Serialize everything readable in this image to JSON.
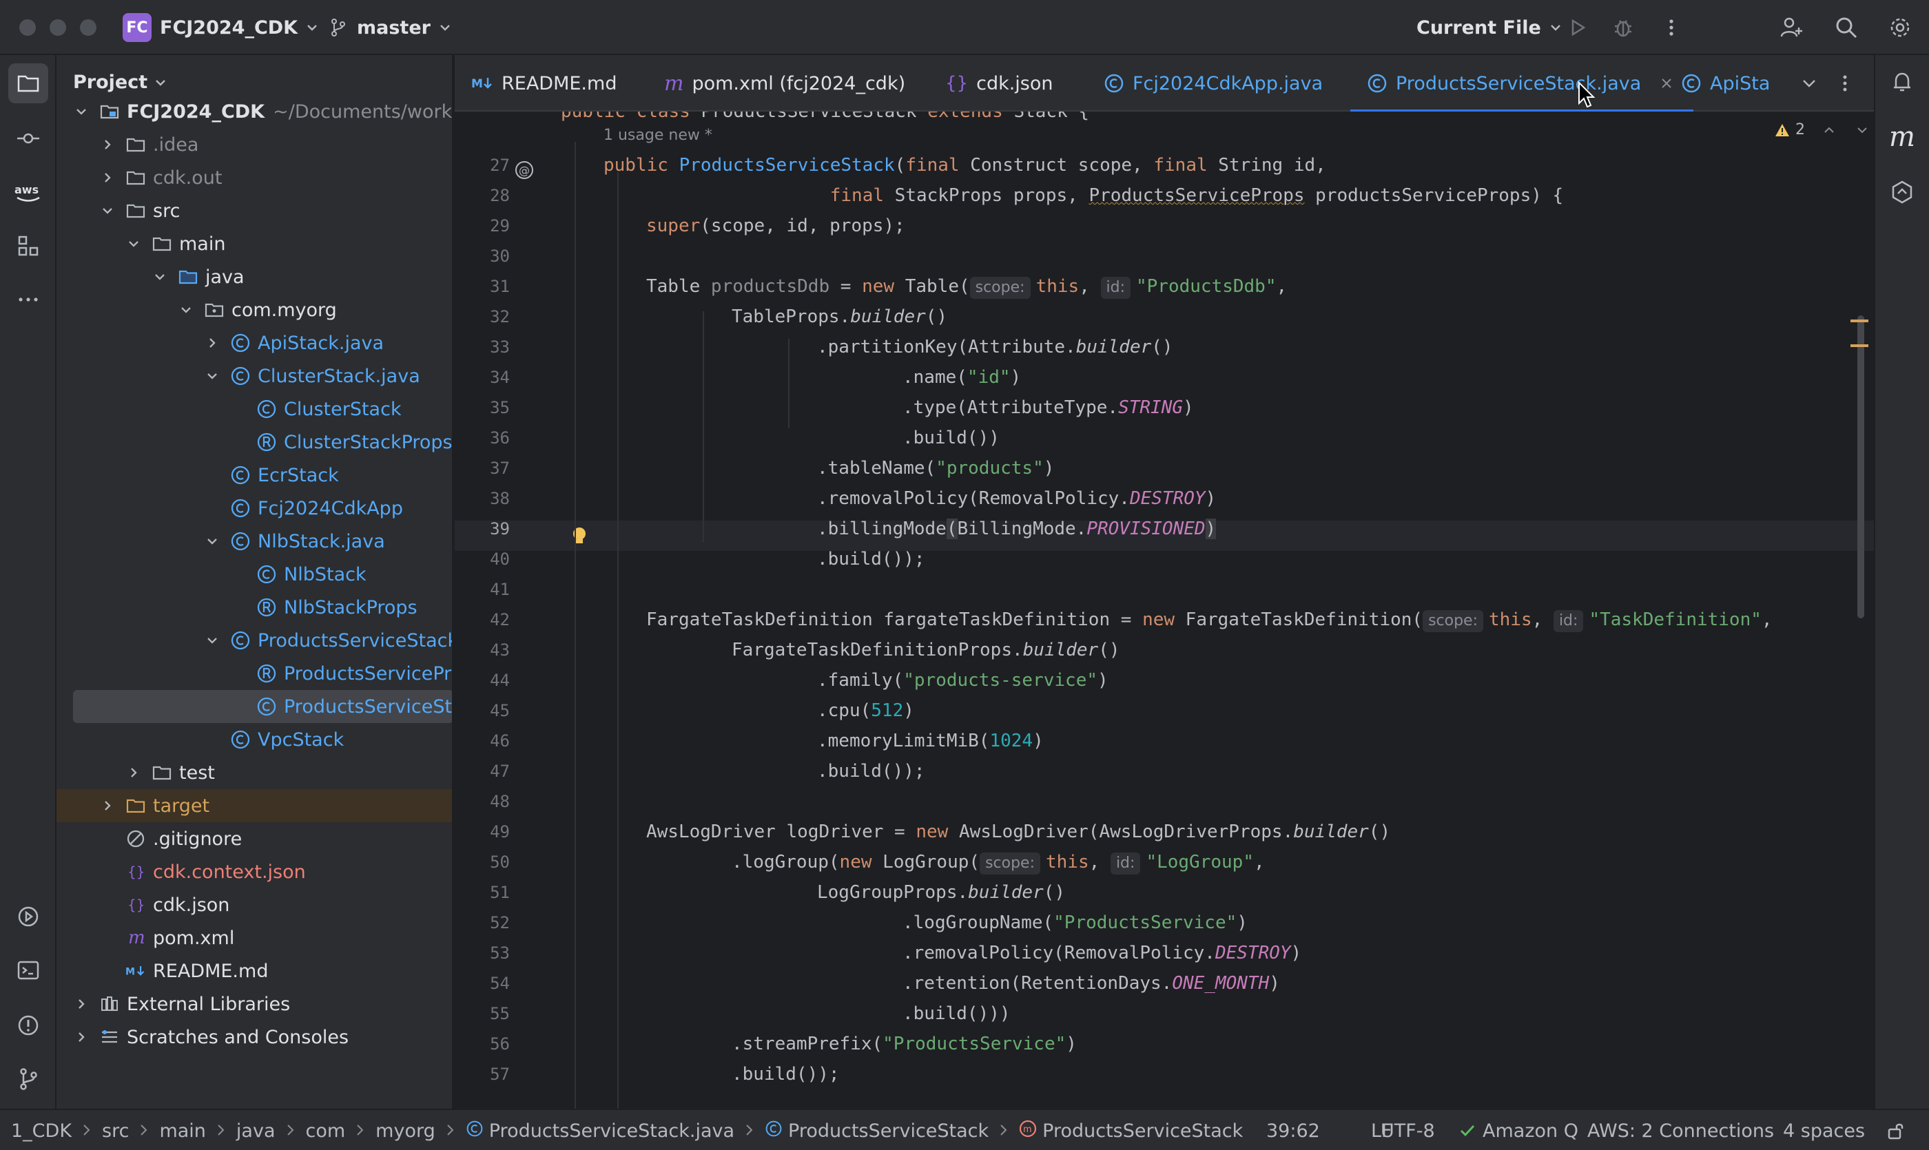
{
  "titlebar": {
    "project_badge": "FC",
    "project_name": "FCJ2024_CDK",
    "branch": "master",
    "run_config": "Current File"
  },
  "project_panel": {
    "title": "Project",
    "tree": [
      {
        "label": "FCJ2024_CDK",
        "hint": "~/Documents/worksho",
        "indent": 0,
        "chev": "down",
        "icon": "module-folder-icon",
        "color": "white",
        "bold": true
      },
      {
        "label": ".idea",
        "indent": 1,
        "chev": "right",
        "icon": "folder-icon",
        "color": "gray"
      },
      {
        "label": "cdk.out",
        "indent": 1,
        "chev": "right",
        "icon": "folder-icon",
        "color": "gray"
      },
      {
        "label": "src",
        "indent": 1,
        "chev": "down",
        "icon": "folder-icon",
        "color": "white"
      },
      {
        "label": "main",
        "indent": 2,
        "chev": "down",
        "icon": "folder-icon",
        "color": "white"
      },
      {
        "label": "java",
        "indent": 3,
        "chev": "down",
        "icon": "source-folder-icon",
        "color": "white"
      },
      {
        "label": "com.myorg",
        "indent": 4,
        "chev": "down",
        "icon": "package-icon",
        "color": "white"
      },
      {
        "label": "ApiStack.java",
        "indent": 5,
        "chev": "right",
        "icon": "class-icon",
        "color": "cls"
      },
      {
        "label": "ClusterStack.java",
        "indent": 5,
        "chev": "down",
        "icon": "class-icon",
        "color": "cls"
      },
      {
        "label": "ClusterStack",
        "indent": 6,
        "chev": "none",
        "icon": "class-icon",
        "color": "cls"
      },
      {
        "label": "ClusterStackProps",
        "indent": 6,
        "chev": "none",
        "icon": "record-icon",
        "color": "cls"
      },
      {
        "label": "EcrStack",
        "indent": 5,
        "chev": "none",
        "icon": "class-icon",
        "color": "cls"
      },
      {
        "label": "Fcj2024CdkApp",
        "indent": 5,
        "chev": "none",
        "icon": "class-icon",
        "color": "cls"
      },
      {
        "label": "NlbStack.java",
        "indent": 5,
        "chev": "down",
        "icon": "class-icon",
        "color": "cls"
      },
      {
        "label": "NlbStack",
        "indent": 6,
        "chev": "none",
        "icon": "class-icon",
        "color": "cls"
      },
      {
        "label": "NlbStackProps",
        "indent": 6,
        "chev": "none",
        "icon": "record-icon",
        "color": "cls"
      },
      {
        "label": "ProductsServiceStack.j",
        "indent": 5,
        "chev": "down",
        "icon": "class-icon",
        "color": "cls"
      },
      {
        "label": "ProductsServicePro",
        "indent": 6,
        "chev": "none",
        "icon": "record-icon",
        "color": "cls"
      },
      {
        "label": "ProductsServiceSta",
        "indent": 6,
        "chev": "none",
        "icon": "class-icon",
        "color": "cls",
        "selected": true
      },
      {
        "label": "VpcStack",
        "indent": 5,
        "chev": "none",
        "icon": "class-icon",
        "color": "cls"
      },
      {
        "label": "test",
        "indent": 2,
        "chev": "right",
        "icon": "folder-icon",
        "color": "white"
      },
      {
        "label": "target",
        "indent": 1,
        "chev": "right",
        "icon": "excluded-folder-icon",
        "color": "orange",
        "excluded": true
      },
      {
        "label": ".gitignore",
        "indent": 1,
        "chev": "none",
        "icon": "ignore-file-icon",
        "color": "white"
      },
      {
        "label": "cdk.context.json",
        "indent": 1,
        "chev": "none",
        "icon": "json-icon",
        "color": "red"
      },
      {
        "label": "cdk.json",
        "indent": 1,
        "chev": "none",
        "icon": "json-icon",
        "color": "white"
      },
      {
        "label": "pom.xml",
        "indent": 1,
        "chev": "none",
        "icon": "maven-icon",
        "color": "white"
      },
      {
        "label": "README.md",
        "indent": 1,
        "chev": "none",
        "icon": "markdown-icon",
        "color": "white"
      },
      {
        "label": "External Libraries",
        "indent": 0,
        "chev": "right",
        "icon": "libraries-icon",
        "color": "white"
      },
      {
        "label": "Scratches and Consoles",
        "indent": 0,
        "chev": "right",
        "icon": "scratches-icon",
        "color": "white"
      }
    ]
  },
  "tabs": [
    {
      "label": "README.md",
      "icon": "markdown-icon",
      "active": false
    },
    {
      "label": "pom.xml (fcj2024_cdk)",
      "icon": "maven-icon",
      "active": false
    },
    {
      "label": "cdk.json",
      "icon": "json-icon",
      "active": false
    },
    {
      "label": "Fcj2024CdkApp.java",
      "icon": "class-icon",
      "active": false
    },
    {
      "label": "ProductsServiceStack.java",
      "icon": "class-icon",
      "active": true
    },
    {
      "label": "ApiStack",
      "icon": "class-icon",
      "active": false
    }
  ],
  "editor": {
    "top_partial": "public class ProductsServiceStack extends Stack {",
    "usage_hint": "1 usage   new *",
    "warnings_count": "2",
    "line_numbers": [
      "27",
      "28",
      "29",
      "30",
      "31",
      "32",
      "33",
      "34",
      "35",
      "36",
      "37",
      "38",
      "39",
      "40",
      "41",
      "42",
      "43",
      "44",
      "45",
      "46",
      "47",
      "48",
      "49",
      "50",
      "51",
      "52",
      "53",
      "54",
      "55",
      "56",
      "57"
    ],
    "current_line": "39"
  },
  "breadcrumb": [
    "1_CDK",
    "src",
    "main",
    "java",
    "com",
    "myorg",
    "ProductsServiceStack.java",
    "ProductsServiceStack",
    "ProductsServiceStack"
  ],
  "status": {
    "position": "39:62",
    "line_sep": "LF",
    "encoding": "UTF-8",
    "amazon_q": "Amazon Q",
    "aws": "AWS: 2 Connections",
    "indent": "4 spaces"
  }
}
